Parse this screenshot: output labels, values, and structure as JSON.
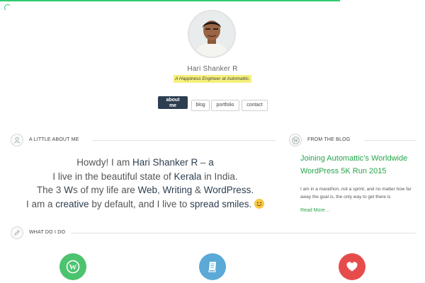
{
  "progress": 0.8,
  "profile": {
    "name": "Hari Shanker R",
    "tagline": "A Happiness Engineer at Automattic."
  },
  "nav": {
    "about_line1": "about",
    "about_line2": "me",
    "blog": "blog",
    "portfolio": "portfolio",
    "contact": "contact"
  },
  "about": {
    "heading": "A LITTLE ABOUT ME",
    "l1_pre": "Howdy! I am ",
    "l1_name": "Hari Shanker R",
    "l1_mid": " – ",
    "l1_end": "a",
    "l2_pre": "I live in the beautiful state of ",
    "l2_state": "Kerala",
    "l2_post": " in India.",
    "l3_pre": "The 3 ",
    "l3_w": "W",
    "l3_mid": "s of my life are ",
    "l3_web": "Web",
    "l3_c1": ", ",
    "l3_writing": "Writing",
    "l3_amp": " & ",
    "l3_wp": "WordPress.",
    "l4_pre": "I am a ",
    "l4_creative": "creative",
    "l4_mid": " by default, and I live to ",
    "l4_smiles": "spread smiles",
    "l4_end": ". "
  },
  "blog": {
    "heading": "FROM THE BLOG",
    "post_title": "Joining Automattic’s Worldwide WordPress 5K Run 2015",
    "excerpt": "I am in a marathon, not a sprint, and no matter how far away the goal is, the only way to get there is",
    "read_more": "Read More…"
  },
  "whatido": {
    "heading": "WHAT DO I DO"
  },
  "colors": {
    "accent": "#2ecc71",
    "link": "#27a54a",
    "nav_active": "#2c3e50",
    "highlight": "#f5f07a",
    "wp_circle": "#4cc36e",
    "book_circle": "#5aa9d6",
    "heart_circle": "#e74c4c"
  },
  "icons": [
    "spinner-icon",
    "user-icon",
    "wordpress-icon",
    "pencil-icon",
    "book-icon",
    "heart-icon",
    "smiley-icon"
  ]
}
